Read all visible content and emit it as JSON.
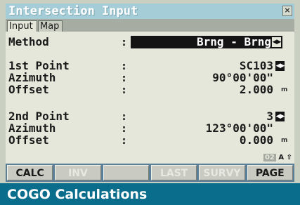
{
  "window": {
    "title": "Intersection Input",
    "close_label": "×"
  },
  "tabs": [
    {
      "label": "Input"
    },
    {
      "label": "Map"
    }
  ],
  "fields": {
    "method": {
      "label": "Method",
      "colon": ":",
      "value": "Brng - Brng",
      "icon": "left-right-arrows-icon"
    },
    "point1": {
      "label": "1st Point",
      "colon": ":",
      "value": "SC103",
      "icon": "left-right-arrows-icon"
    },
    "azimuth1": {
      "label": "Azimuth",
      "colon": ":",
      "value": "90°00'00\""
    },
    "offset1": {
      "label": "Offset",
      "colon": ":",
      "value": "2.000",
      "unit": "m"
    },
    "point2": {
      "label": "2nd Point",
      "colon": ":",
      "value": "3",
      "icon": "left-right-arrows-icon"
    },
    "azimuth2": {
      "label": "Azimuth",
      "colon": ":",
      "value": "123°00'00\""
    },
    "offset2": {
      "label": "Offset",
      "colon": ":",
      "value": "0.000",
      "unit": "m"
    }
  },
  "status": {
    "number": "02",
    "mode": "A",
    "shift_icon": "up-arrow-icon",
    "shift_glyph": "⇧"
  },
  "softkeys": [
    {
      "label": "CALC",
      "enabled": true
    },
    {
      "label": "INV",
      "enabled": false
    },
    {
      "label": "",
      "enabled": false
    },
    {
      "label": "LAST",
      "enabled": false
    },
    {
      "label": "SURVY",
      "enabled": false
    },
    {
      "label": "PAGE",
      "enabled": true
    }
  ],
  "caption": "COGO Calculations",
  "colors": {
    "titlebar": "#a4cdd8",
    "screen_bg": "#e4e7da",
    "softkey_bar": "#5b7f97",
    "caption_bg": "#0b6d8c"
  }
}
